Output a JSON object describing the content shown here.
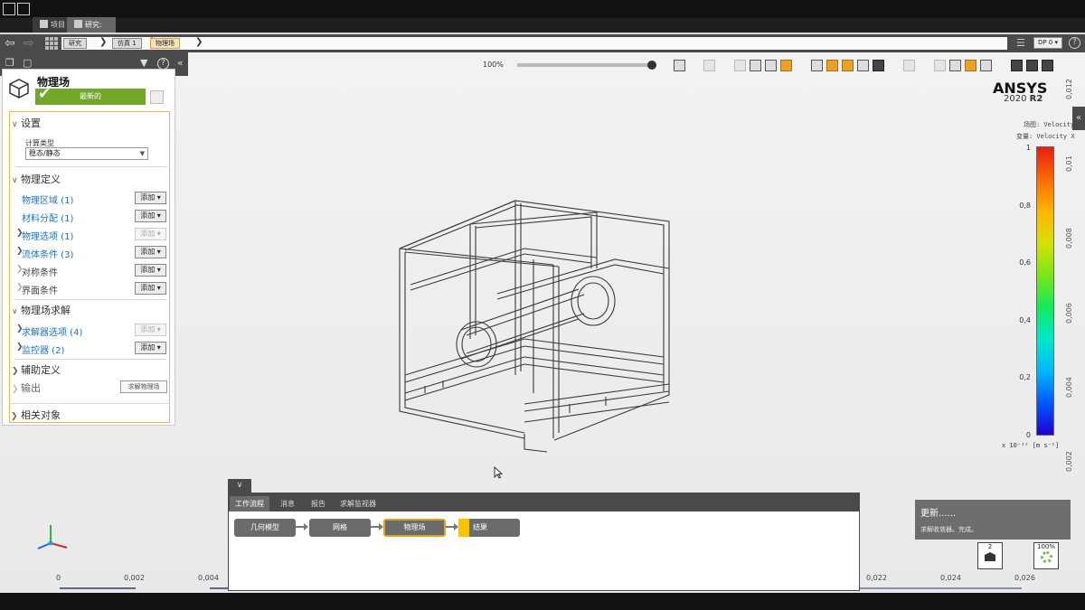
{
  "tabs": {
    "project": "项目",
    "study": "研究: 结果"
  },
  "breadcrumb": [
    "研究",
    "仿真 1",
    "物理场"
  ],
  "dp_label": "DP 0",
  "left_panel": {
    "title": "物理场",
    "status": "最新的",
    "sections": {
      "setup": "设置",
      "calc_type_label": "计算类型",
      "calc_type_value": "稳态/静态",
      "physics_def": "物理定义",
      "physics_solve": "物理场求解",
      "aux_def": "辅助定义",
      "output": "输出",
      "related": "相关对象"
    },
    "items": {
      "physics_region": "物理区域 (1)",
      "material_assign": "材料分配 (1)",
      "physics_options": "物理选项 (1)",
      "fluid_conditions": "流体条件 (3)",
      "symmetry": "对称条件",
      "interface": "界面条件",
      "solver_options": "求解器选项 (4)",
      "monitors": "监控器 (2)"
    },
    "add_label": "添加",
    "solve_button": "求解物理场"
  },
  "toolbar": {
    "zoom": "100%"
  },
  "branding": {
    "name": "ANSYS",
    "version": "2020",
    "release": "R2"
  },
  "legend": {
    "field_line": "场图: Velocity",
    "variable_line": "变量: Velocity X",
    "ticks": [
      "1",
      "0,8",
      "0,6",
      "0,4",
      "0,2",
      "0"
    ],
    "unit": "x 10⁻¹² [m s⁻¹]"
  },
  "right_ruler": [
    "0,012",
    "0,01",
    "0,008",
    "0,006",
    "0,004",
    "0,002"
  ],
  "bottom_axis": [
    "0",
    "0,002",
    "0,004",
    "0,022",
    "0,024",
    "0,026"
  ],
  "workflow": {
    "tabs": [
      "工作流程",
      "消息",
      "报告",
      "求解监视器"
    ],
    "nodes": [
      "几何模型",
      "网格",
      "物理场",
      "结果"
    ]
  },
  "notification": {
    "title": "更新......",
    "message": "求解收敛器。完成。"
  },
  "mini_boxes": {
    "count": "2",
    "percent": "100%"
  },
  "colors": {
    "accent": "#e39f20",
    "status_green": "#73a72b",
    "link_blue": "#2373b6"
  }
}
